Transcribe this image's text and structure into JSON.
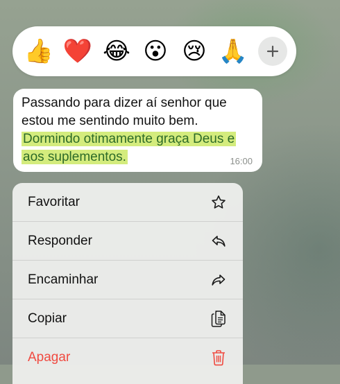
{
  "reactions": [
    "👍",
    "❤️",
    "😂",
    "😮",
    "😢",
    "🙏"
  ],
  "message": {
    "line_plain": "Passando para dizer aí senhor que estou me sentindo muito bem.",
    "line_highlighted": "Dormindo otimamente graça Deus e aos suplementos.",
    "time": "16:00"
  },
  "menu": {
    "items": [
      {
        "label": "Favoritar",
        "icon": "star-icon"
      },
      {
        "label": "Responder",
        "icon": "reply-icon"
      },
      {
        "label": "Encaminhar",
        "icon": "forward-icon"
      },
      {
        "label": "Copiar",
        "icon": "copy-icon"
      },
      {
        "label": "Apagar",
        "icon": "trash-icon"
      }
    ]
  },
  "colors": {
    "highlight": "#d4ec7d",
    "highlight_text": "#2d6b28",
    "destructive": "#f04a40"
  }
}
